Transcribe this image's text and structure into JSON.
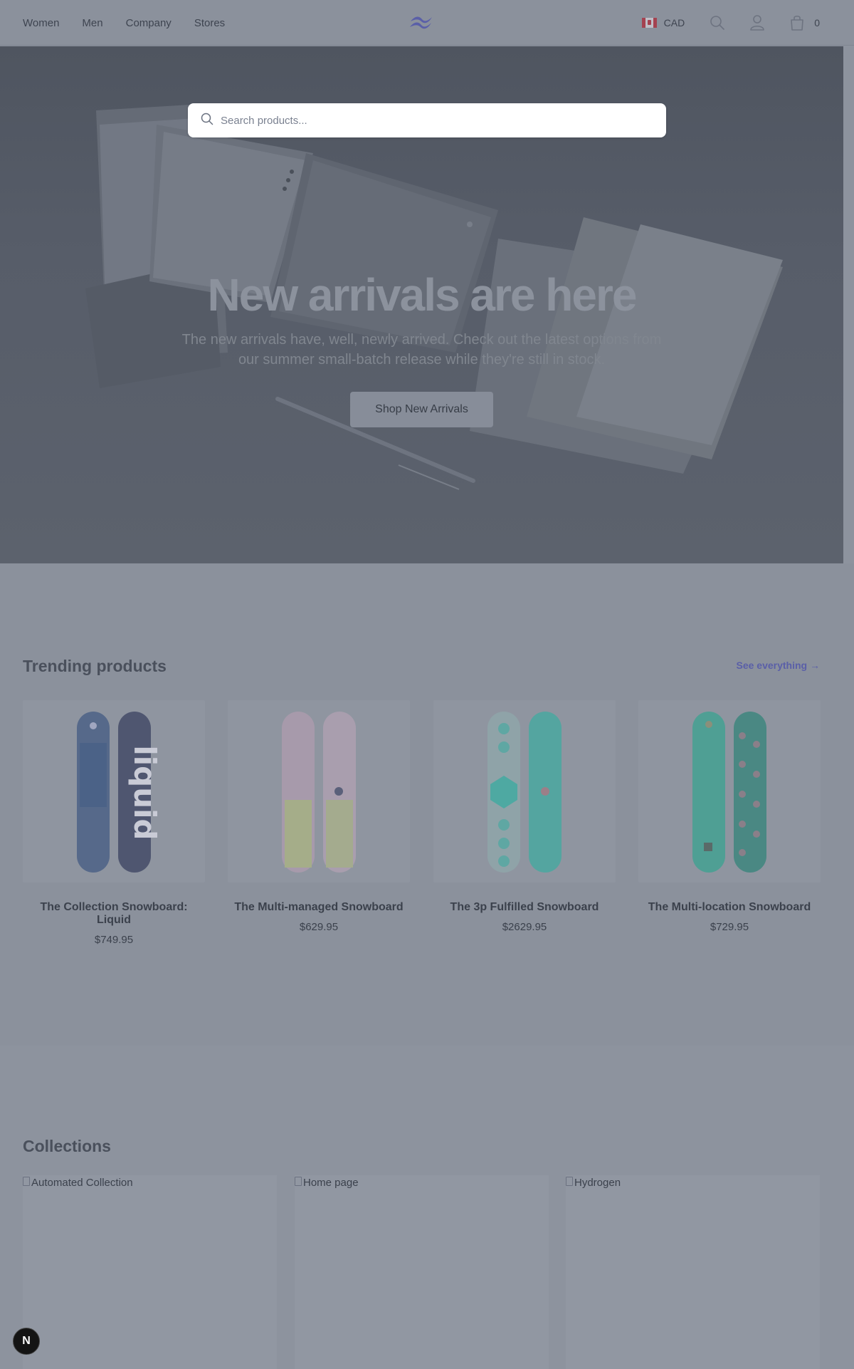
{
  "header": {
    "nav": [
      "Women",
      "Men",
      "Company",
      "Stores"
    ],
    "logo_icon": "tailwind-wave-logo",
    "currency": "CAD",
    "flag_icon": "canada-flag-icon",
    "cart_count": "0"
  },
  "search": {
    "placeholder": "Search products..."
  },
  "hero": {
    "title": "New arrivals are here",
    "subtitle": "The new arrivals have, well, newly arrived. Check out the latest options from our summer small-batch release while they're still in stock.",
    "cta": "Shop New Arrivals"
  },
  "trending": {
    "title": "Trending products",
    "see_all": "See everything →",
    "products": [
      {
        "name": "The Collection Snowboard: Liquid",
        "price": "$749.95"
      },
      {
        "name": "The Multi-managed Snowboard",
        "price": "$629.95"
      },
      {
        "name": "The 3p Fulfilled Snowboard",
        "price": "$2629.95"
      },
      {
        "name": "The Multi-location Snowboard",
        "price": "$729.95"
      }
    ]
  },
  "collections": {
    "title": "Collections",
    "items": [
      {
        "alt": "Automated Collection"
      },
      {
        "alt": "Home page"
      },
      {
        "alt": "Hydrogen"
      }
    ]
  },
  "badge": {
    "label": "N"
  },
  "colors": {
    "overlay": "#8d939e",
    "hero_bg": "#575d69",
    "accent_link": "#5a5fa8"
  }
}
